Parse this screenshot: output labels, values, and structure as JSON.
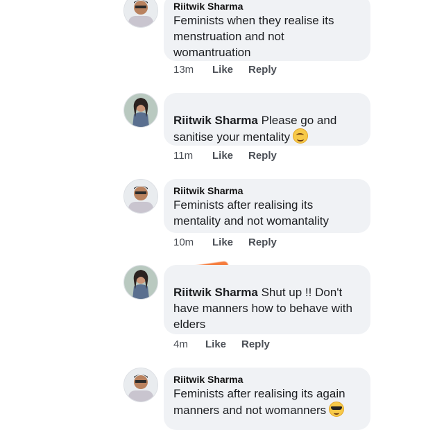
{
  "comments": [
    {
      "author": "Riitwik Sharma",
      "text": "Feminists when they realise its menstruation and not womantruation",
      "time": "13m",
      "like": "Like",
      "reply": "Reply",
      "avatar": "man-avatar"
    },
    {
      "author": "Riitwik Sharma",
      "text": " Please go and sanitise your mentality",
      "emoji": "smiling-face-icon",
      "time": "11m",
      "like": "Like",
      "reply": "Reply",
      "avatar": "woman-avatar"
    },
    {
      "author": "Riitwik Sharma",
      "text": "Feminists after realising its mentality and not womantality",
      "time": "10m",
      "like": "Like",
      "reply": "Reply",
      "avatar": "man-avatar"
    },
    {
      "author": "Riitwik Sharma",
      "text": " Shut up !! Don't have manners how to behave with elders",
      "time": "4m",
      "like": "Like",
      "reply": "Reply",
      "avatar": "woman-avatar"
    },
    {
      "author": "Riitwik Sharma",
      "text": "Feminists after realising its again manners and not womanners",
      "emoji": "sunglasses-face-icon",
      "avatar": "man-avatar"
    }
  ],
  "colors": {
    "bubble": "#f0f2f5",
    "redaction": "#f57c3d",
    "meta_text": "#4b4f56"
  }
}
